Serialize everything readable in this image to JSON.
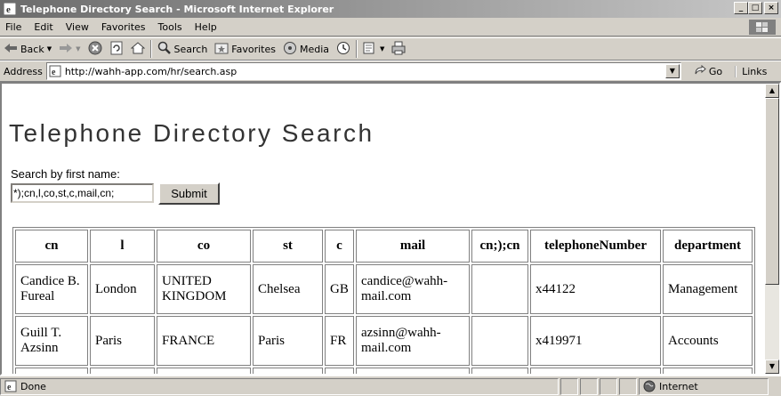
{
  "window": {
    "title": "Telephone Directory Search - Microsoft Internet Explorer",
    "minimize": "_",
    "maximize": "□",
    "close": "×"
  },
  "menu": [
    "File",
    "Edit",
    "View",
    "Favorites",
    "Tools",
    "Help"
  ],
  "toolbar": {
    "back_label": "Back",
    "search_label": "Search",
    "favorites_label": "Favorites",
    "media_label": "Media"
  },
  "address": {
    "label": "Address",
    "url": "http://wahh-app.com/hr/search.asp",
    "go_label": "Go",
    "links_label": "Links"
  },
  "page": {
    "title": "Telephone Directory Search",
    "search_label": "Search by first name:",
    "search_value": "*);cn,l,co,st,c,mail,cn;",
    "submit_label": "Submit"
  },
  "table": {
    "headers": [
      "cn",
      "l",
      "co",
      "st",
      "c",
      "mail",
      "cn;);cn",
      "telephoneNumber",
      "department"
    ],
    "rows": [
      [
        "Candice B. Fureal",
        "London",
        "UNITED KINGDOM",
        "Chelsea",
        "GB",
        "candice@wahh-mail.com",
        "",
        "x44122",
        "Management"
      ],
      [
        "Guill T. Azsinn",
        "Paris",
        "FRANCE",
        "Paris",
        "FR",
        "azsinn@wahh-mail.com",
        "",
        "x419971",
        "Accounts"
      ]
    ]
  },
  "status": {
    "text": "Done",
    "zone": "Internet"
  },
  "icons": [
    "ie-icon",
    "back-icon",
    "forward-icon",
    "stop-icon",
    "refresh-icon",
    "home-icon",
    "search-icon",
    "favorites-icon",
    "media-icon",
    "history-icon",
    "mail-icon",
    "print-icon",
    "go-icon",
    "windows-logo-icon",
    "page-icon",
    "globe-icon"
  ]
}
